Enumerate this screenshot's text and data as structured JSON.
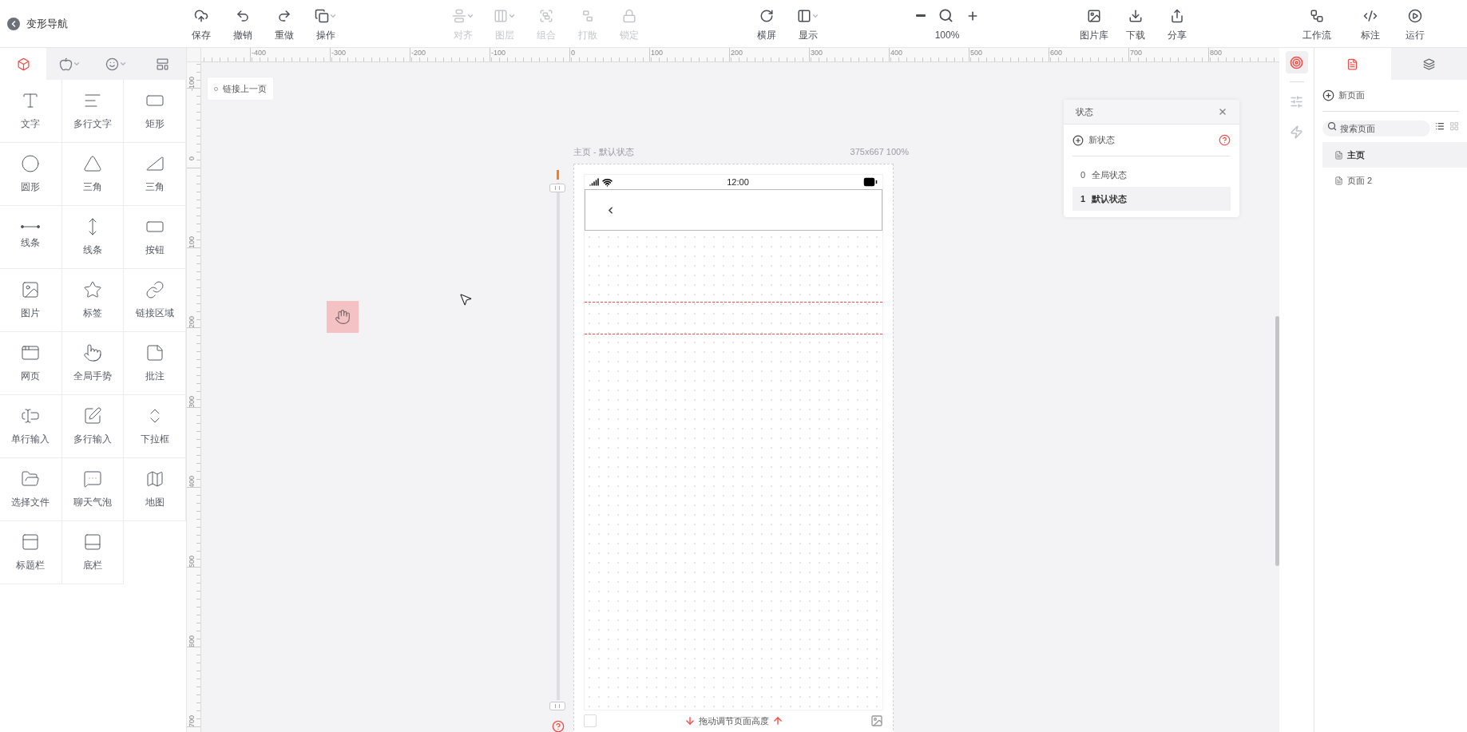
{
  "header": {
    "back_title": "变形导航"
  },
  "toolbar_groups": [
    {
      "items": [
        {
          "kind": "save",
          "label": "保存",
          "disabled": false,
          "caret": false
        },
        {
          "kind": "undo",
          "label": "撤销",
          "disabled": false,
          "caret": false
        },
        {
          "kind": "redo",
          "label": "重做",
          "disabled": false,
          "caret": false
        },
        {
          "kind": "operate",
          "label": "操作",
          "disabled": false,
          "caret": true
        }
      ]
    },
    {
      "items": [
        {
          "kind": "align",
          "label": "对齐",
          "disabled": true,
          "caret": true
        },
        {
          "kind": "layer",
          "label": "图层",
          "disabled": true,
          "caret": true
        },
        {
          "kind": "group",
          "label": "组合",
          "disabled": true,
          "caret": false
        },
        {
          "kind": "ungroup",
          "label": "打散",
          "disabled": true,
          "caret": false
        },
        {
          "kind": "lock",
          "label": "锁定",
          "disabled": true,
          "caret": false
        }
      ]
    },
    {
      "items": [
        {
          "kind": "rotate",
          "label": "横屏",
          "disabled": false,
          "caret": false
        },
        {
          "kind": "display",
          "label": "显示",
          "disabled": false,
          "caret": true
        }
      ]
    },
    {
      "items": [
        {
          "kind": "zoom",
          "label": "100%",
          "disabled": false,
          "caret": false
        }
      ]
    },
    {
      "items": [
        {
          "kind": "gallery",
          "label": "图片库",
          "disabled": false,
          "caret": false
        },
        {
          "kind": "download",
          "label": "下载",
          "disabled": false,
          "caret": false
        },
        {
          "kind": "share",
          "label": "分享",
          "disabled": false,
          "caret": false
        }
      ]
    },
    {
      "items": [
        {
          "kind": "workflow",
          "label": "工作流",
          "disabled": false,
          "caret": false
        },
        {
          "kind": "annotate",
          "label": "标注",
          "disabled": false,
          "caret": false
        },
        {
          "kind": "run",
          "label": "运行",
          "disabled": false,
          "caret": false
        }
      ]
    }
  ],
  "left_tabs": [
    {
      "kind": "components",
      "selected": true,
      "caret": false
    },
    {
      "kind": "apple",
      "selected": false,
      "caret": true
    },
    {
      "kind": "emoji",
      "selected": false,
      "caret": true
    },
    {
      "kind": "layout",
      "selected": false,
      "caret": false
    }
  ],
  "widgets": [
    {
      "label": "文字"
    },
    {
      "label": "多行文字"
    },
    {
      "label": "矩形"
    },
    {
      "label": "圆形"
    },
    {
      "label": "三角"
    },
    {
      "label": "三角"
    },
    {
      "label": "线条"
    },
    {
      "label": "线条"
    },
    {
      "label": "按钮"
    },
    {
      "label": "图片"
    },
    {
      "label": "标签"
    },
    {
      "label": "链接区域"
    },
    {
      "label": "网页"
    },
    {
      "label": "全局手势"
    },
    {
      "label": "批注"
    },
    {
      "label": "单行输入"
    },
    {
      "label": "多行输入"
    },
    {
      "label": "下拉框"
    },
    {
      "label": "选择文件"
    },
    {
      "label": "聊天气泡"
    },
    {
      "label": "地图"
    },
    {
      "label": "标题栏"
    },
    {
      "label": "底栏"
    }
  ],
  "ruler": {
    "x_labels": [
      "-400",
      "-300",
      "-200",
      "-100",
      "0",
      "100",
      "200",
      "300",
      "400",
      "500",
      "600",
      "700",
      "800"
    ],
    "y_labels": [
      "-100",
      "0",
      "100",
      "200",
      "300",
      "400",
      "500",
      "600",
      "700"
    ]
  },
  "canvas": {
    "link_button": "链接上一页"
  },
  "phone": {
    "title": "主页 - 默认状态",
    "size": "375x667 100%",
    "time": "12:00",
    "footer_hint": "拖动调节页面高度",
    "footer_checked": false
  },
  "states_panel": {
    "title": "状态",
    "new_label": "新状态",
    "items": [
      {
        "index": "0",
        "label": "全局状态",
        "selected": false
      },
      {
        "index": "1",
        "label": "默认状态",
        "selected": true
      }
    ]
  },
  "right_strip": [
    {
      "kind": "target",
      "selected": true
    },
    {
      "kind": "sliders",
      "selected": false
    },
    {
      "kind": "lightning",
      "selected": false
    }
  ],
  "right_tabs": [
    {
      "kind": "pages",
      "selected": true
    },
    {
      "kind": "layers",
      "selected": false
    }
  ],
  "pages": {
    "new_label": "新页面",
    "search_placeholder": "搜索页面",
    "view_modes": [
      {
        "kind": "list",
        "selected": true
      },
      {
        "kind": "grid",
        "selected": false
      }
    ],
    "items": [
      {
        "label": "主页",
        "selected": true
      },
      {
        "label": "页面 2",
        "selected": false
      }
    ]
  }
}
